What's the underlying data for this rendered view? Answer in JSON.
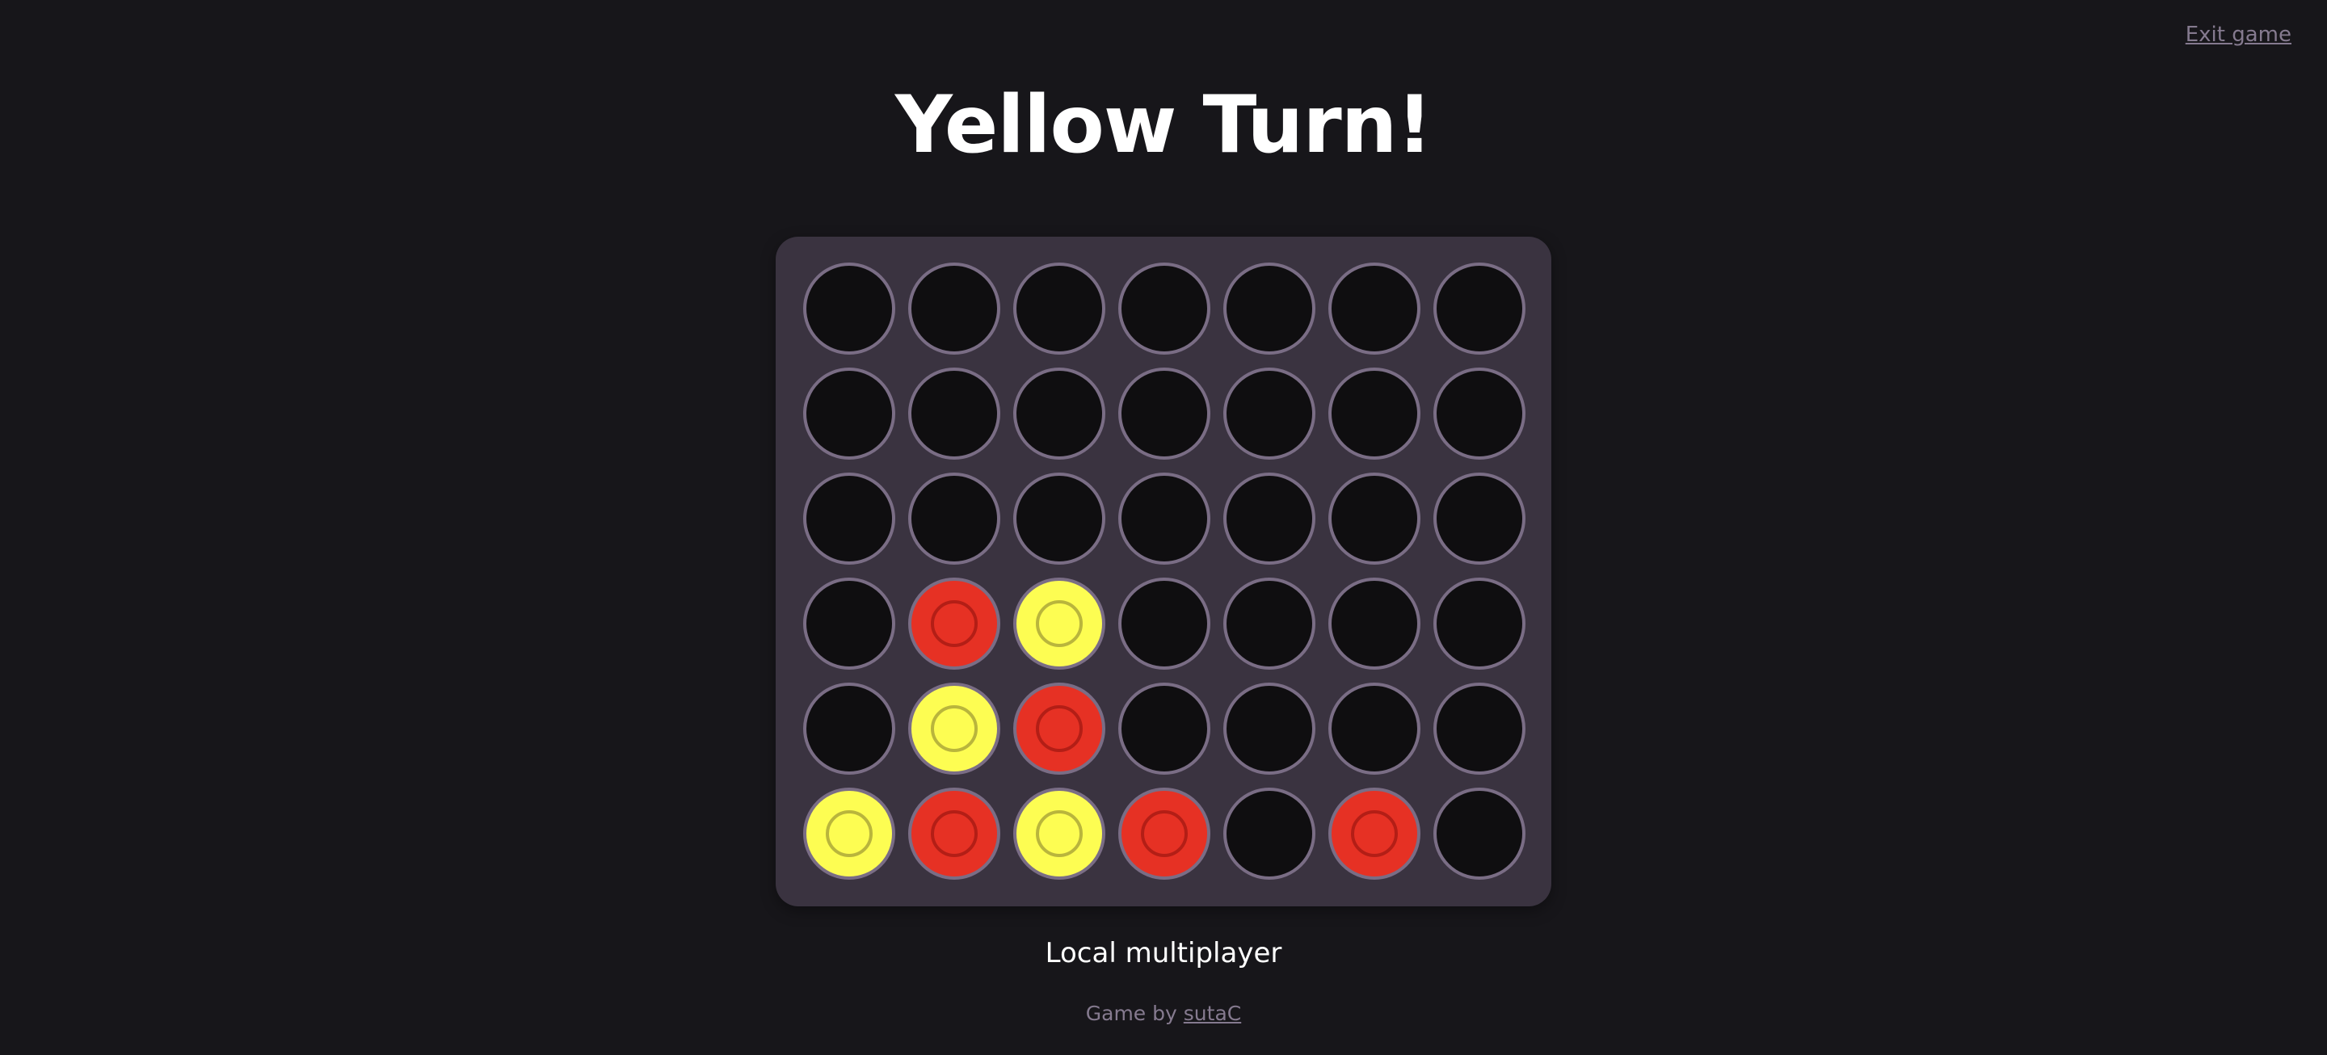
{
  "header": {
    "exit_label": "Exit game",
    "title": "Yellow Turn!"
  },
  "board": {
    "columns": 7,
    "rows": 6,
    "grid": [
      [
        "empty",
        "empty",
        "empty",
        "empty",
        "empty",
        "empty",
        "empty"
      ],
      [
        "empty",
        "empty",
        "empty",
        "empty",
        "empty",
        "empty",
        "empty"
      ],
      [
        "empty",
        "empty",
        "empty",
        "empty",
        "empty",
        "empty",
        "empty"
      ],
      [
        "empty",
        "red",
        "yellow",
        "empty",
        "empty",
        "empty",
        "empty"
      ],
      [
        "empty",
        "yellow",
        "red",
        "empty",
        "empty",
        "empty",
        "empty"
      ],
      [
        "yellow",
        "red",
        "yellow",
        "red",
        "empty",
        "red",
        "empty"
      ]
    ],
    "colors": {
      "red": "#e63124",
      "yellow": "#fdfd52",
      "empty": "#0f0e10",
      "board": "#3a3340"
    }
  },
  "footer": {
    "mode_label": "Local multiplayer",
    "credit_prefix": "Game by",
    "author_link": "sutaC"
  }
}
